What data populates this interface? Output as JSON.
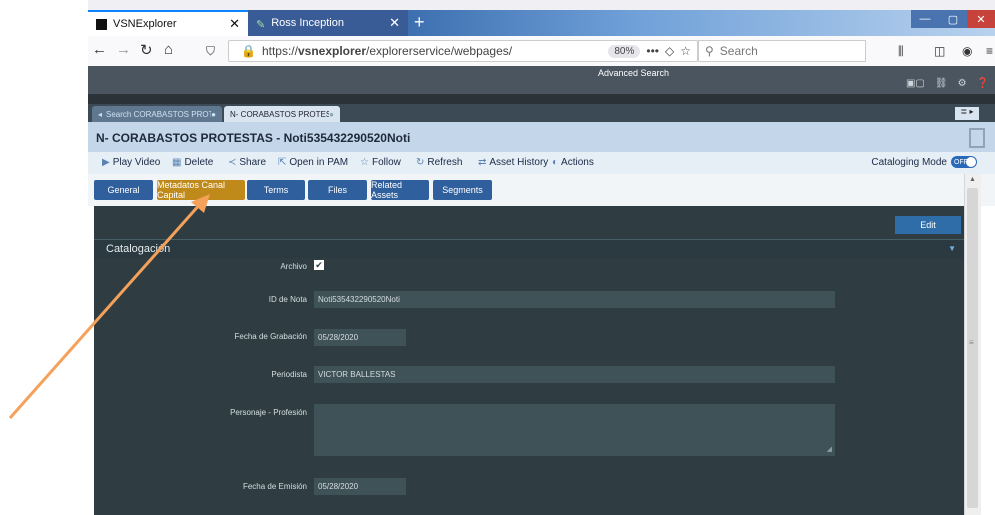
{
  "browser": {
    "tabs": [
      {
        "label": "VSNExplorer",
        "active": true
      },
      {
        "label": "Ross Inception",
        "active": false
      }
    ],
    "url_prefix": "https://",
    "url_host": "vsnexplorer",
    "url_path": "/explorerservice/webpages/",
    "zoom": "80%",
    "search_placeholder": "Search"
  },
  "app": {
    "advanced_search": "Advanced Search",
    "asset_tabs": [
      "Search CORABASTOS PROT...",
      "N- CORABASTOS PROTESTA..."
    ],
    "asset_title": "N- CORABASTOS PROTESTAS - Noti535432290520Noti",
    "toolbar": [
      "Play Video",
      "Delete",
      "Share",
      "Open in PAM",
      "Follow",
      "Refresh",
      "Asset History",
      "Actions"
    ],
    "cataloging_mode": "Cataloging Mode",
    "toggle_state": "OFF",
    "subtabs": [
      "General",
      "Metadatos Canal Capital",
      "Terms",
      "Files",
      "Related Assets",
      "Segments"
    ],
    "active_subtab": "Metadatos Canal Capital",
    "edit_label": "Edit",
    "section_label": "Catalogación",
    "fields": {
      "archivo_label": "Archivo",
      "archivo_checked": true,
      "id_label": "ID de Nota",
      "id_value": "Noti535432290520Noti",
      "fecha_grab_label": "Fecha de Grabación",
      "fecha_grab_value": "05/28/2020",
      "periodista_label": "Periodista",
      "periodista_value": "VICTOR BALLESTAS",
      "personaje_label": "Personaje - Profesión",
      "personaje_value": "",
      "fecha_emision_label": "Fecha de Emisión",
      "fecha_emision_value": "05/28/2020"
    }
  },
  "colors": {
    "accent_arrow": "#f5a15a",
    "active_subtab": "#c08a1a",
    "subtab": "#2f5f9c"
  }
}
